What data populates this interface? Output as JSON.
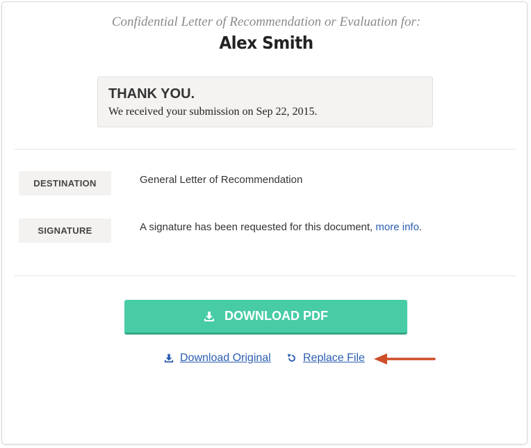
{
  "header": {
    "subtitle": "Confidential Letter of Recommendation or Evaluation for:",
    "name": "Alex Smith"
  },
  "confirmation": {
    "title": "THANK YOU.",
    "text": "We received your submission on Sep 22, 2015."
  },
  "details": {
    "destination_label": "DESTINATION",
    "destination_value": "General Letter of Recommendation",
    "signature_label": "SIGNATURE",
    "signature_value": "A signature has been requested for this document,",
    "signature_link": "more info",
    "signature_end": "."
  },
  "actions": {
    "download_pdf": "DOWNLOAD PDF",
    "download_original": "Download Original",
    "replace_file": "Replace File"
  },
  "colors": {
    "primary_button": "#47cca6",
    "link": "#2a5db0",
    "arrow": "#cf4e2a"
  }
}
